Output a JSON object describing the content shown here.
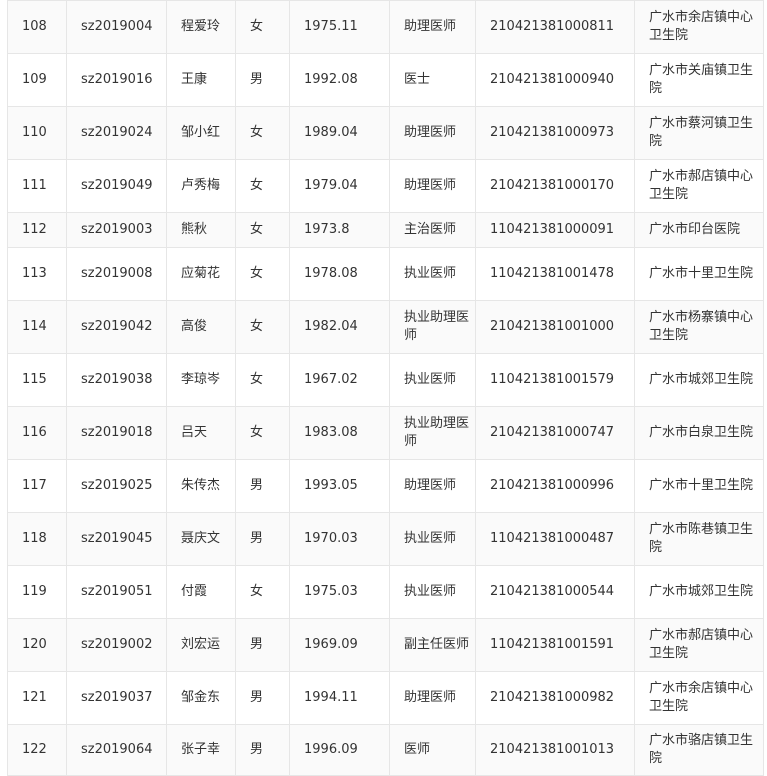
{
  "rows": [
    {
      "no": "108",
      "id": "sz2019004",
      "name": "程爱玲",
      "gender": "女",
      "born": "1975.11",
      "title": "助理医师",
      "cert": "210421381000811",
      "unit": "广水市余店镇中心卫生院"
    },
    {
      "no": "109",
      "id": "sz2019016",
      "name": "王康",
      "gender": "男",
      "born": "1992.08",
      "title": "医士",
      "cert": "210421381000940",
      "unit": "广水市关庙镇卫生院"
    },
    {
      "no": "110",
      "id": "sz2019024",
      "name": "邹小红",
      "gender": "女",
      "born": "1989.04",
      "title": "助理医师",
      "cert": "210421381000973",
      "unit": "广水市蔡河镇卫生院"
    },
    {
      "no": "111",
      "id": "sz2019049",
      "name": "卢秀梅",
      "gender": "女",
      "born": "1979.04",
      "title": "助理医师",
      "cert": "210421381000170",
      "unit": "广水市郝店镇中心卫生院"
    },
    {
      "no": "112",
      "id": "sz2019003",
      "name": "熊秋",
      "gender": "女",
      "born": "1973.8",
      "title": "主治医师",
      "cert": "110421381000091",
      "unit": "广水市印台医院"
    },
    {
      "no": "113",
      "id": "sz2019008",
      "name": "应菊花",
      "gender": "女",
      "born": "1978.08",
      "title": "执业医师",
      "cert": "110421381001478",
      "unit": "广水市十里卫生院"
    },
    {
      "no": "114",
      "id": "sz2019042",
      "name": "高俊",
      "gender": "女",
      "born": "1982.04",
      "title": "执业助理医师",
      "cert": "210421381001000",
      "unit": "广水市杨寨镇中心卫生院"
    },
    {
      "no": "115",
      "id": "sz2019038",
      "name": "李琼岑",
      "gender": "女",
      "born": "1967.02",
      "title": "执业医师",
      "cert": "110421381001579",
      "unit": "广水市城郊卫生院"
    },
    {
      "no": "116",
      "id": "sz2019018",
      "name": "吕天",
      "gender": "女",
      "born": "1983.08",
      "title": "执业助理医师",
      "cert": "210421381000747",
      "unit": "广水市白泉卫生院"
    },
    {
      "no": "117",
      "id": "sz2019025",
      "name": "朱传杰",
      "gender": "男",
      "born": "1993.05",
      "title": "助理医师",
      "cert": "210421381000996",
      "unit": "广水市十里卫生院"
    },
    {
      "no": "118",
      "id": "sz2019045",
      "name": "聂庆文",
      "gender": "男",
      "born": "1970.03",
      "title": "执业医师",
      "cert": "110421381000487",
      "unit": "广水市陈巷镇卫生院"
    },
    {
      "no": "119",
      "id": "sz2019051",
      "name": "付霞",
      "gender": "女",
      "born": "1975.03",
      "title": "执业医师",
      "cert": "210421381000544",
      "unit": "广水市城郊卫生院"
    },
    {
      "no": "120",
      "id": "sz2019002",
      "name": "刘宏运",
      "gender": "男",
      "born": "1969.09",
      "title": "副主任医师",
      "cert": "110421381001591",
      "unit": "广水市郝店镇中心卫生院"
    },
    {
      "no": "121",
      "id": "sz2019037",
      "name": "邹金东",
      "gender": "男",
      "born": "1994.11",
      "title": "助理医师",
      "cert": "210421381000982",
      "unit": "广水市余店镇中心卫生院"
    },
    {
      "no": "122",
      "id": "sz2019064",
      "name": "张子幸",
      "gender": "男",
      "born": "1996.09",
      "title": "医师",
      "cert": "210421381001013",
      "unit": "广水市骆店镇卫生院"
    }
  ]
}
